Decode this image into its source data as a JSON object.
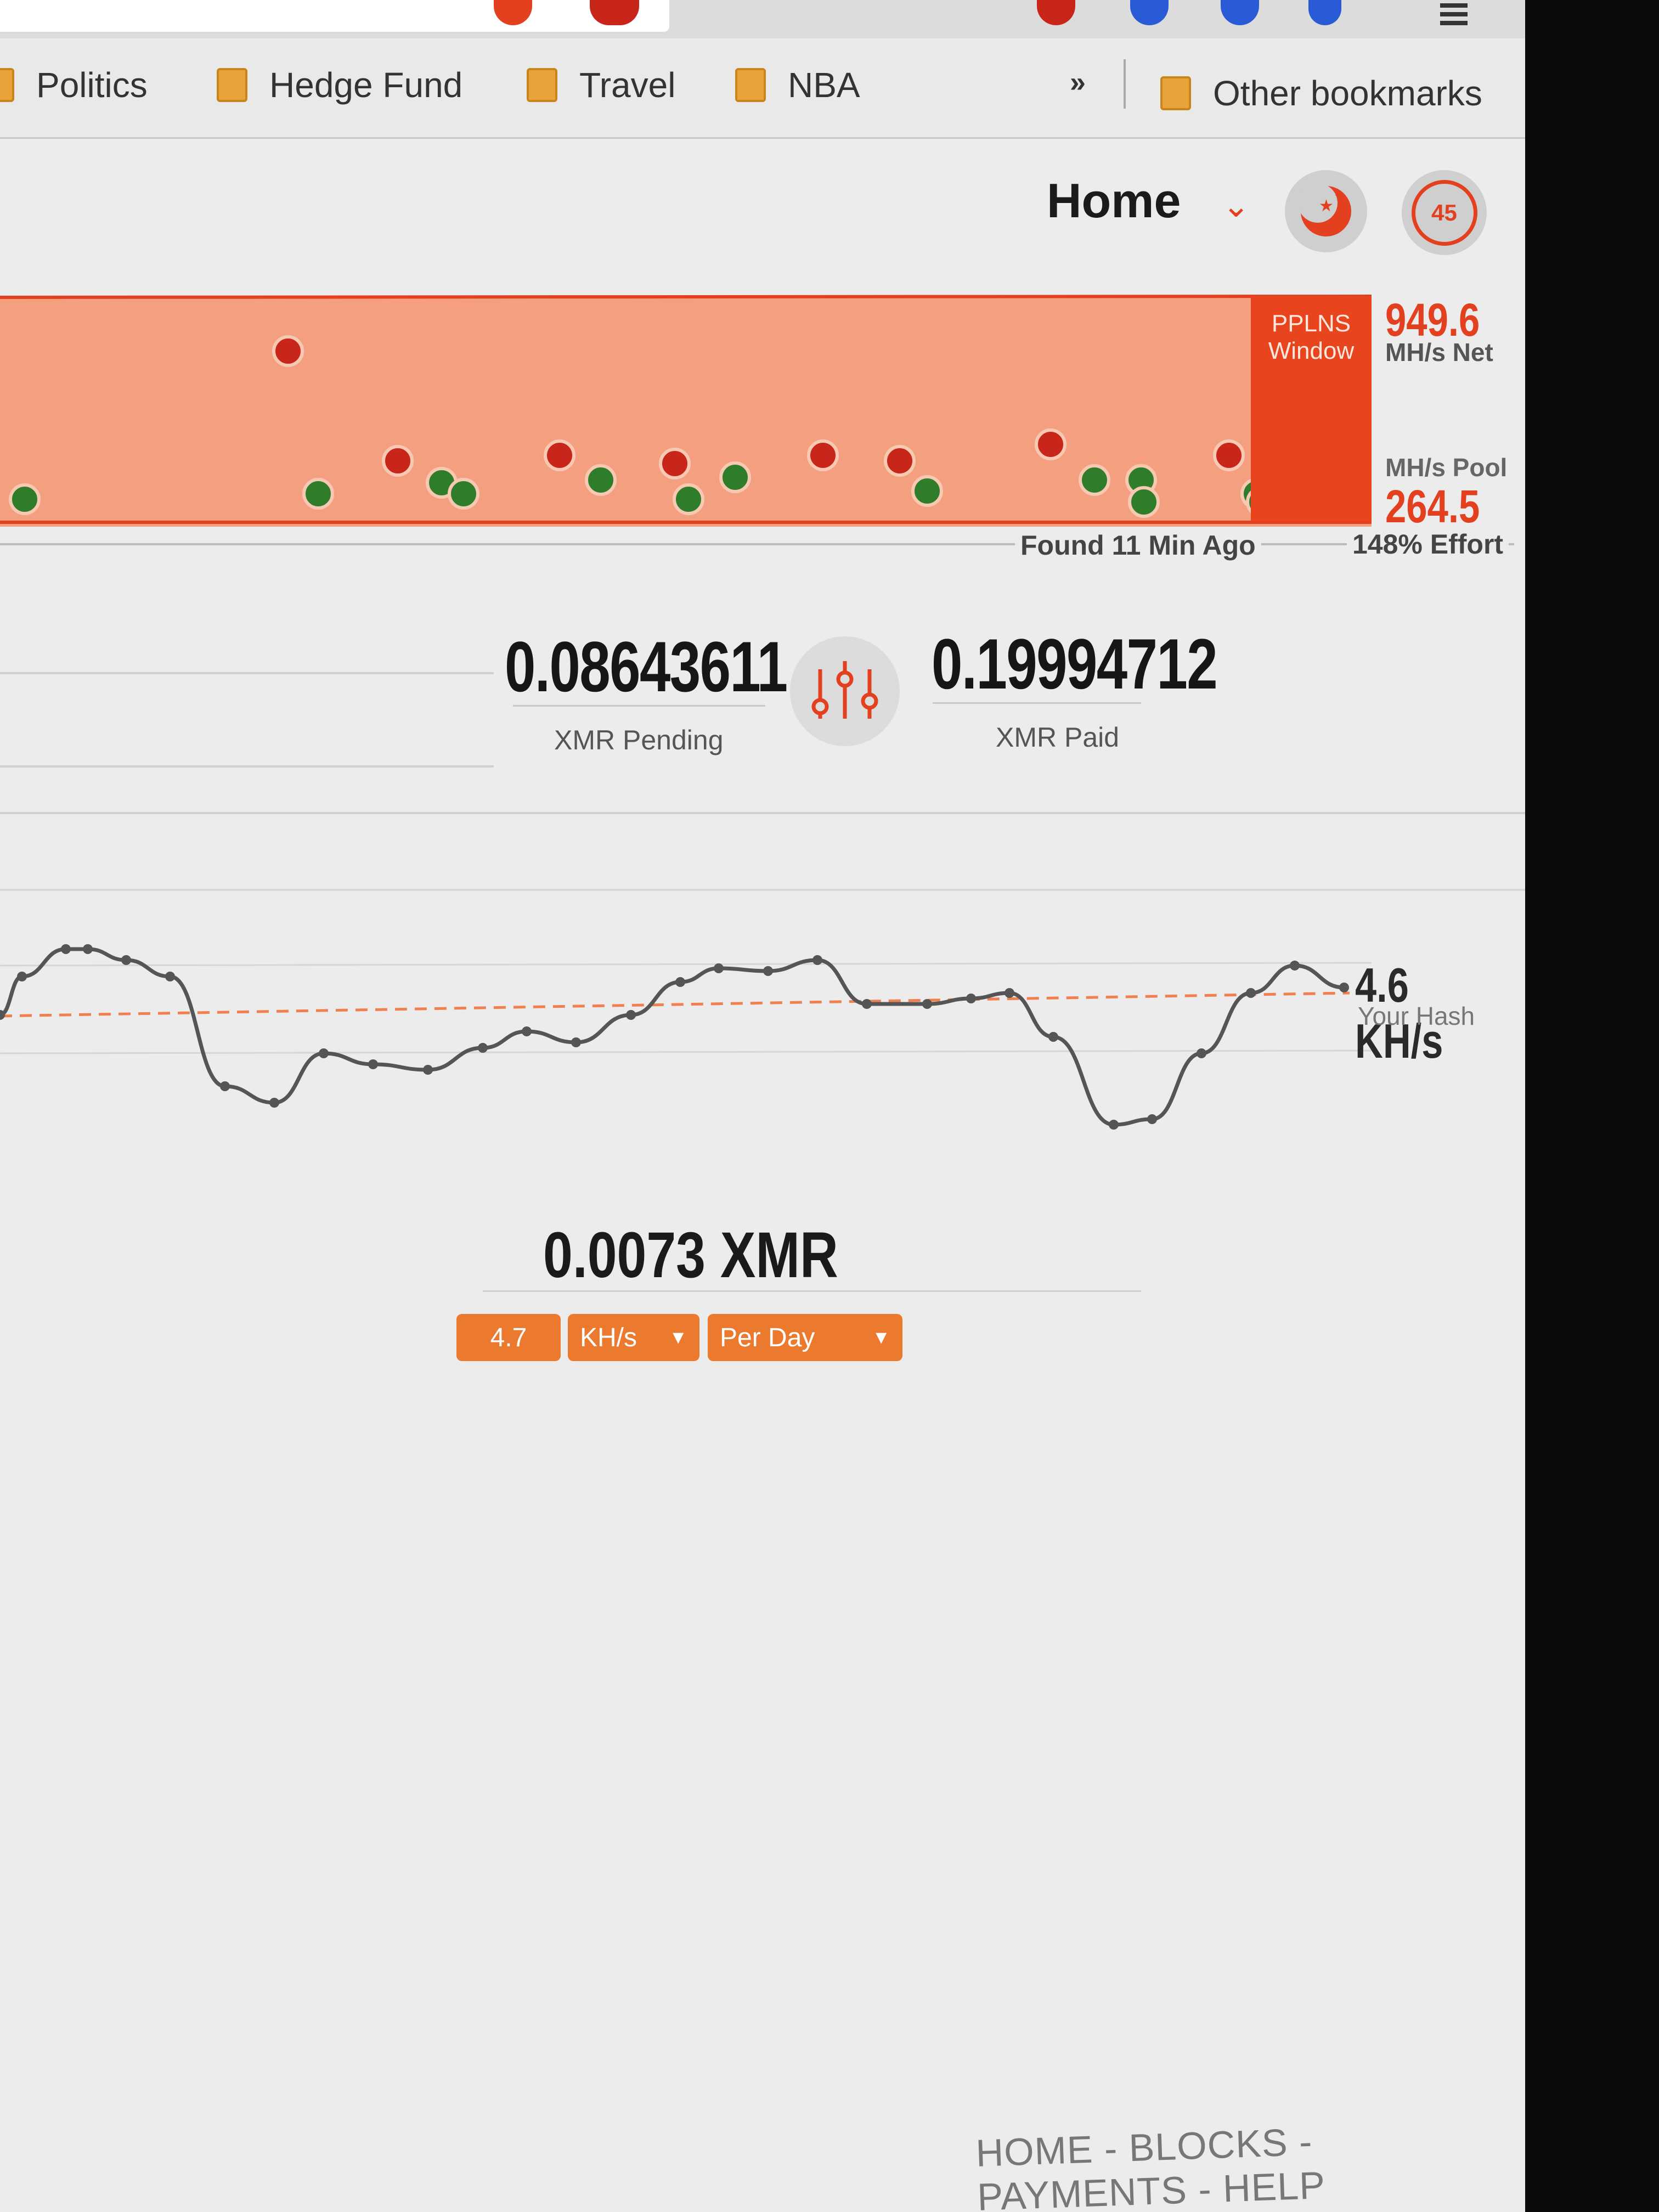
{
  "bookmarks": {
    "items": [
      {
        "label": "Politics"
      },
      {
        "label": "Hedge Fund"
      },
      {
        "label": "Travel"
      },
      {
        "label": "NBA"
      }
    ],
    "overflow_icon": "chevron-double-right-icon",
    "other_label": "Other bookmarks"
  },
  "header": {
    "nav_label": "Home",
    "dropdown_icon": "chevron-down-icon",
    "theme_icon": "moon-stars-icon",
    "refresh_timer": "45"
  },
  "pool_chart": {
    "window_label_line1": "PPLNS",
    "window_label_line2": "Window",
    "net_value": "949.6",
    "net_unit": "MH/s Net",
    "pool_unit": "MH/s Pool",
    "pool_value": "264.5",
    "found_text": "Found 11 Min Ago",
    "effort_text": "148% Effort",
    "colors": {
      "band": "#f4a080",
      "window": "#e8451f",
      "block_red": "#c8261a",
      "block_green": "#2f7d2a"
    }
  },
  "balances": {
    "pending_value": "0.08643611",
    "pending_label": "XMR Pending",
    "paid_value": "0.19994712",
    "paid_label": "XMR Paid",
    "icon": "sliders-icon"
  },
  "hash_chart": {
    "value": "4.6 KH/s",
    "label": "Your Hash"
  },
  "calculator": {
    "result": "0.0073 XMR",
    "hashrate_input": "4.7",
    "unit_select": "KH/s",
    "period_select": "Per Day",
    "select_icon": "caret-down-icon"
  },
  "footer": {
    "links": [
      "HOME",
      "BLOCKS",
      "PAYMENTS",
      "HELP"
    ],
    "separator": " - "
  },
  "accent_color": "#e2401e"
}
